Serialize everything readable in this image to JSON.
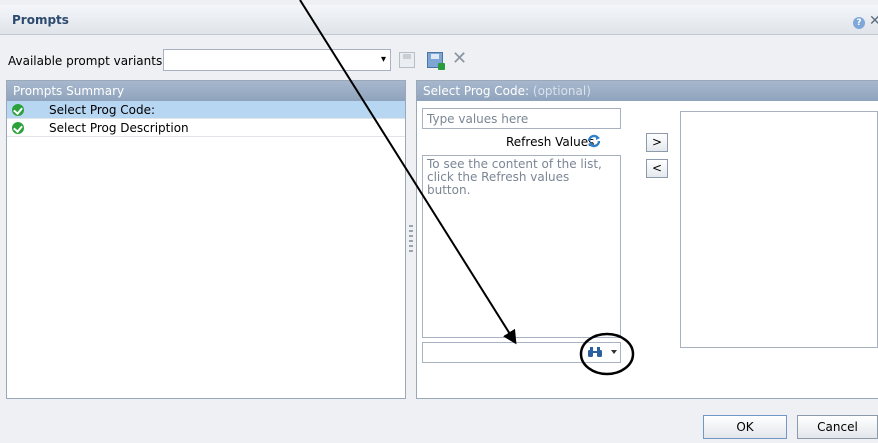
{
  "dialog": {
    "title": "Prompts",
    "help_icon": "help-icon",
    "close_icon": "close-icon"
  },
  "variants": {
    "label": "Available prompt variants",
    "selected_value": "",
    "icons": [
      "save-icon",
      "save-as-icon",
      "delete-icon"
    ]
  },
  "summary": {
    "header": "Prompts Summary",
    "items": [
      {
        "label": "Select Prog Code:",
        "status_icon": "check-icon"
      },
      {
        "label": "Select Prog Description",
        "status_icon": "check-icon"
      }
    ]
  },
  "detail": {
    "header": "Select Prog Code:",
    "header_optional": "(optional)",
    "type_placeholder": "Type values here",
    "refresh_label": "Refresh Values",
    "list_message": "To see the content of the list, click the Refresh values button.",
    "move_right_label": ">",
    "move_left_label": "<",
    "search_icon": "binoculars-icon"
  },
  "footer": {
    "ok_label": "OK",
    "cancel_label": "Cancel"
  },
  "colors": {
    "header_bar": "#8fa3bd",
    "selected_row": "#b7d6f2",
    "check_green": "#2aa13b"
  }
}
